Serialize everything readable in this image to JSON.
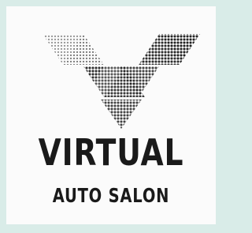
{
  "brand": {
    "title": "VIRTUAL",
    "subtitle": "AUTO SALON",
    "logo_icon": "halftone-v-triangles-icon"
  },
  "colors": {
    "page_background": "#d9ece8",
    "card_background": "#fbfbfb",
    "text": "#1a1a1a",
    "mark_dark": "#1c1c1c",
    "mark_light": "#b8b8b8"
  }
}
